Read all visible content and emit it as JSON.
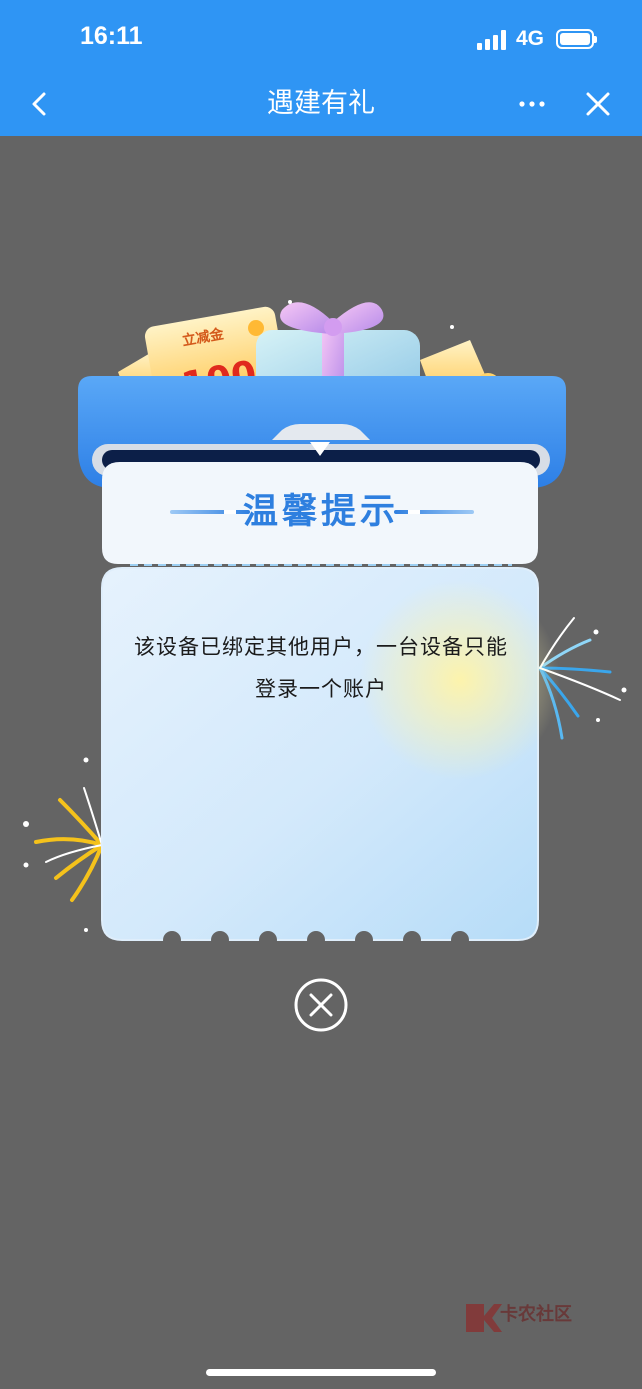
{
  "status_bar": {
    "time": "16:11",
    "network": "4G"
  },
  "nav": {
    "title": "遇建有礼",
    "back_icon": "chevron-left-icon",
    "more_icon": "more-dots-icon",
    "close_icon": "close-icon"
  },
  "modal": {
    "title": "温馨提示",
    "message": "该设备已绑定其他用户，一台设备只能登录一个账户",
    "voucher_label": "立减金",
    "voucher_amount": "100",
    "close_icon": "circle-close-icon"
  },
  "watermark": {
    "text": "卡农社区"
  },
  "colors": {
    "header": "#2f95f4",
    "overlay": "#646464",
    "modal_title": "#2e7fdf",
    "modal_text": "#1b1b1b"
  }
}
